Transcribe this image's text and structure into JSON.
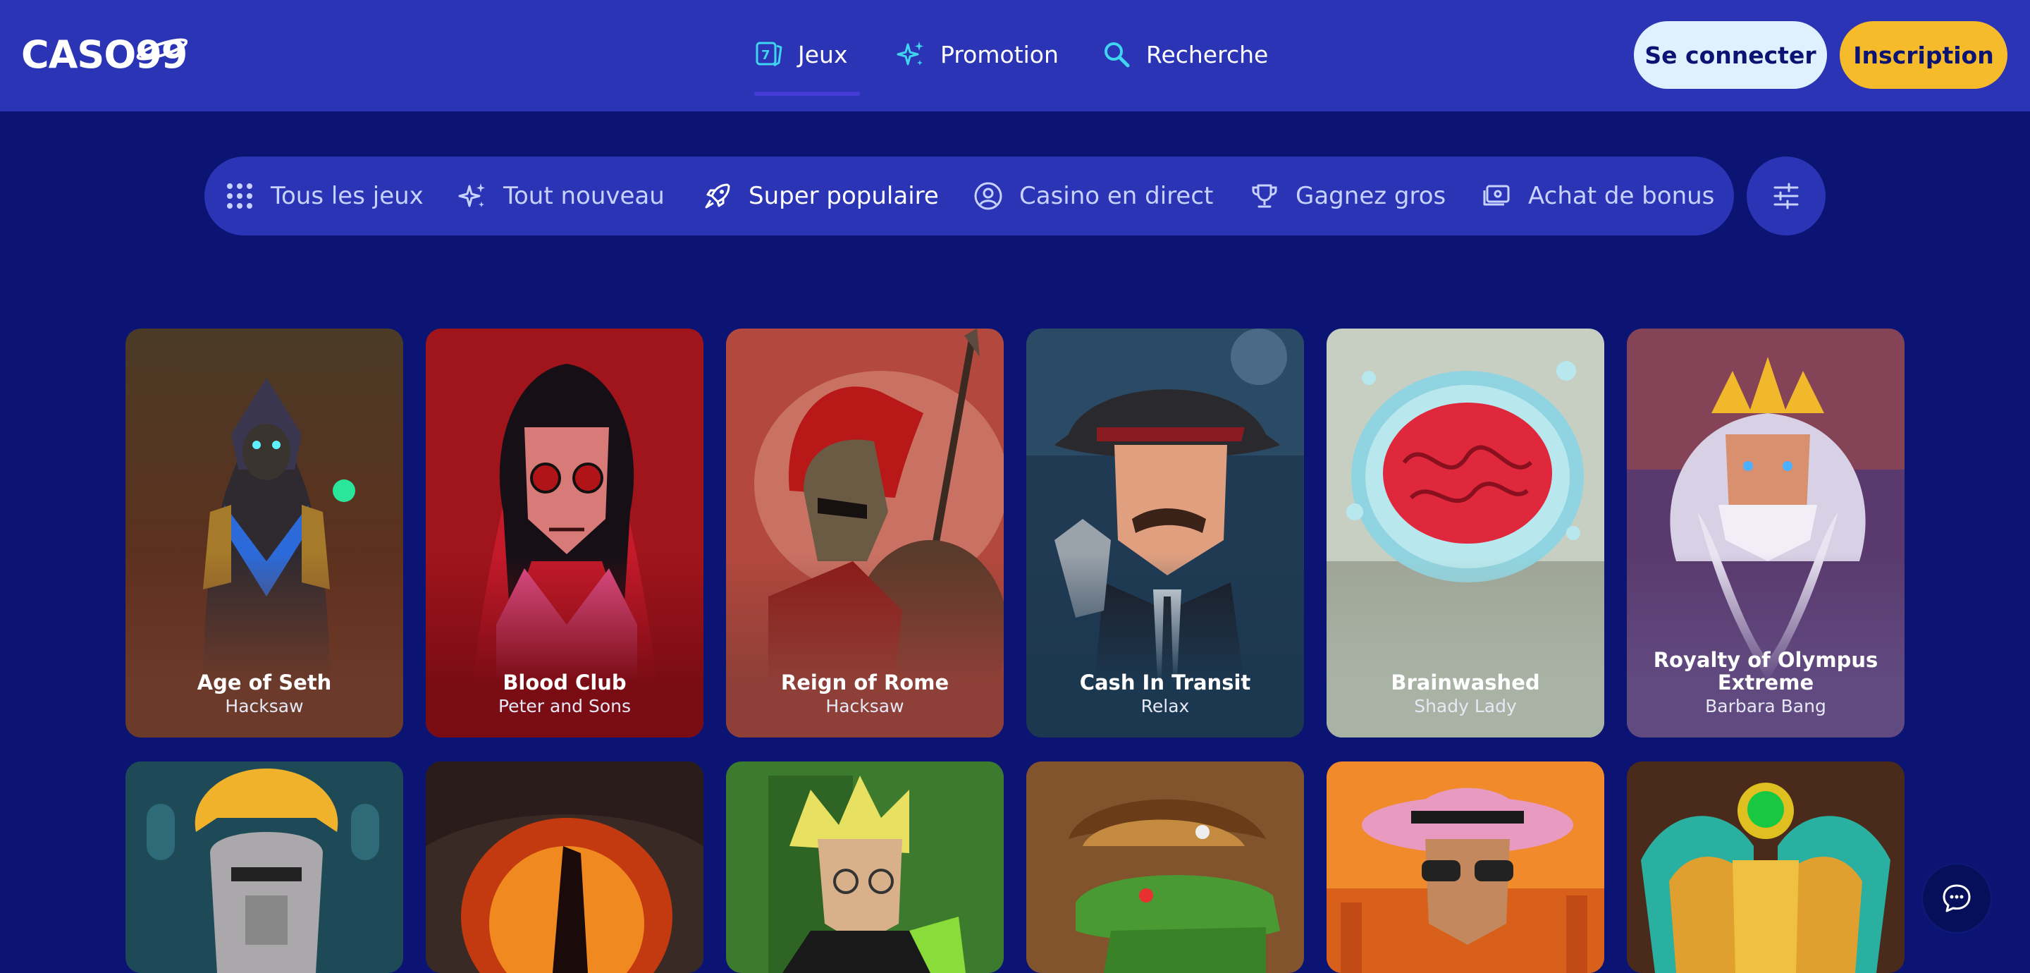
{
  "brand": {
    "logo_text": "CASO99"
  },
  "nav": {
    "items": [
      {
        "label": "Jeux",
        "icon": "dice-seven-icon"
      },
      {
        "label": "Promotion",
        "icon": "sparkles-icon"
      },
      {
        "label": "Recherche",
        "icon": "search-icon"
      }
    ],
    "active": "Jeux"
  },
  "auth": {
    "login_label": "Se connecter",
    "register_label": "Inscription"
  },
  "categories": {
    "items": [
      {
        "label": "Tous les jeux",
        "icon": "grid-dots-icon"
      },
      {
        "label": "Tout nouveau",
        "icon": "sparkles-icon"
      },
      {
        "label": "Super populaire",
        "icon": "rocket-icon"
      },
      {
        "label": "Casino en direct",
        "icon": "user-circle-icon"
      },
      {
        "label": "Gagnez gros",
        "icon": "trophy-icon"
      },
      {
        "label": "Achat de bonus",
        "icon": "cash-icon"
      }
    ],
    "active": "Super populaire",
    "filter_icon": "sliders-icon"
  },
  "games": [
    {
      "title": "Age of Seth",
      "provider": "Hacksaw"
    },
    {
      "title": "Blood Club",
      "provider": "Peter and Sons"
    },
    {
      "title": "Reign of Rome",
      "provider": "Hacksaw"
    },
    {
      "title": "Cash In Transit",
      "provider": "Relax"
    },
    {
      "title": "Brainwashed",
      "provider": "Shady Lady"
    },
    {
      "title": "Royalty of Olympus Extreme",
      "provider": "Barbara Bang"
    }
  ],
  "chat": {
    "icon": "chat-bubble-icon"
  },
  "colors": {
    "background": "#0b1473",
    "nav_bg": "#2a34b4",
    "accent_yellow": "#f6bb2a",
    "login_bg": "#dff0ff",
    "icon_cyan": "#3fd4f0"
  }
}
